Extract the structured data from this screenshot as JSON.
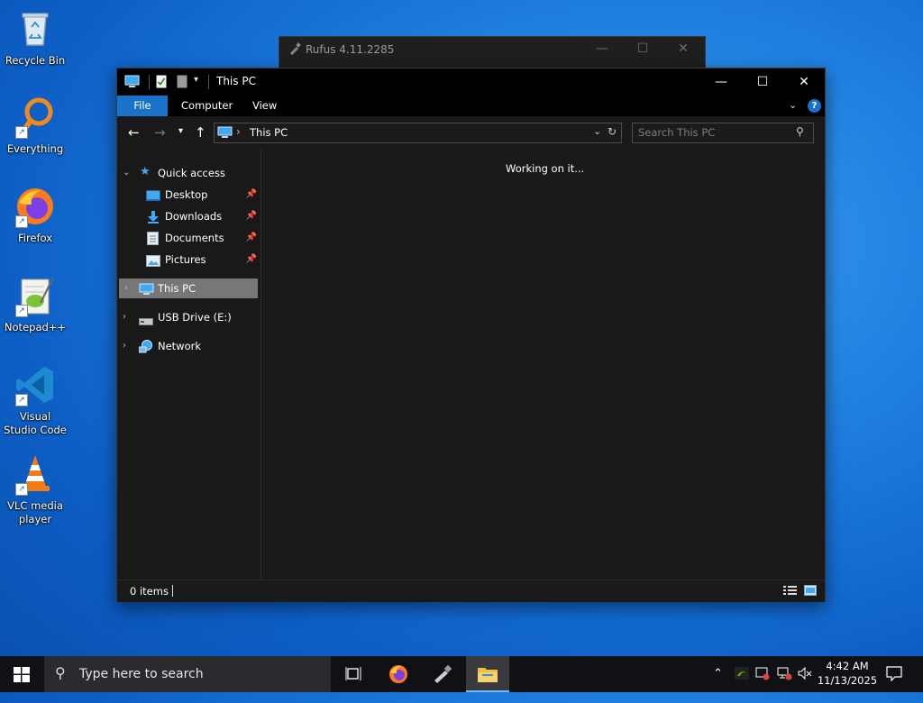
{
  "desktop": {
    "icons": [
      {
        "label": "Recycle Bin"
      },
      {
        "label": "Everything"
      },
      {
        "label": "Firefox"
      },
      {
        "label": "Notepad++"
      },
      {
        "label": "Visual Studio Code"
      },
      {
        "label": "VLC media player"
      }
    ]
  },
  "rufus": {
    "title": "Rufus 4.11.2285",
    "minimize": "—",
    "maximize": "☐",
    "close": "✕"
  },
  "explorer": {
    "title": "This PC",
    "window": {
      "minimize": "—",
      "maximize": "☐",
      "close": "✕"
    },
    "ribbon": {
      "tabs": [
        {
          "label": "File"
        },
        {
          "label": "Computer"
        },
        {
          "label": "View"
        }
      ]
    },
    "address": {
      "path_separator": "›",
      "location": "This PC"
    },
    "search": {
      "placeholder": "Search This PC"
    },
    "nav": {
      "quick_access": "Quick access",
      "quick_items": [
        {
          "label": "Desktop"
        },
        {
          "label": "Downloads"
        },
        {
          "label": "Documents"
        },
        {
          "label": "Pictures"
        }
      ],
      "this_pc": "This PC",
      "usb": "USB Drive (E:)",
      "network": "Network"
    },
    "content": {
      "status_message": "Working on it..."
    },
    "statusbar": {
      "items": "0 items"
    }
  },
  "taskbar": {
    "search_placeholder": "Type here to search",
    "clock": {
      "time": "4:42 AM",
      "date": "11/13/2025"
    }
  },
  "colors": {
    "accent": "#1a73c8",
    "selected_nav": "#777777",
    "window_bg": "#191919"
  }
}
